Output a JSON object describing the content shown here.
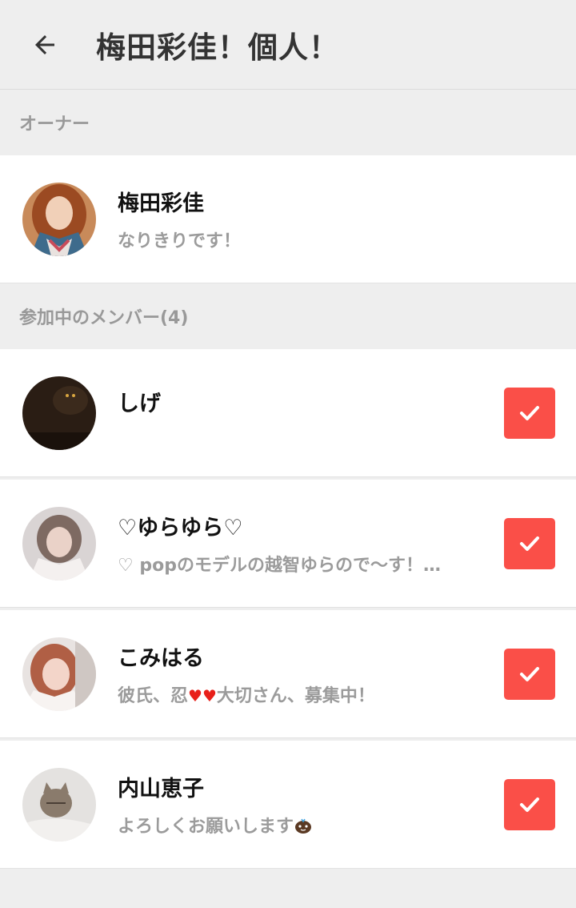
{
  "header": {
    "title": "梅田彩佳！個人！"
  },
  "owner_section": {
    "label": "オーナー",
    "owner": {
      "name": "梅田彩佳",
      "status": "なりきりです！"
    }
  },
  "members_section": {
    "label": "参加中のメンバー(4)",
    "members": [
      {
        "name": "しげ",
        "status": ""
      },
      {
        "name": "♡ゆらゆら♡",
        "status": "♡ popのモデルの越智ゆらので〜す！…"
      },
      {
        "name": "こみはる",
        "status_pre": "彼氏、忍",
        "status_post": "大切さん、募集中！"
      },
      {
        "name": "内山恵子",
        "status": "よろしくお願いします"
      }
    ]
  },
  "colors": {
    "accent": "#fa4f48",
    "background": "#eeeeee",
    "card": "#ffffff"
  },
  "icons": {
    "back": "arrow-left-icon",
    "check": "checkmark-icon",
    "heart": "heart-icon",
    "emoji": "face-emoji-icon"
  }
}
